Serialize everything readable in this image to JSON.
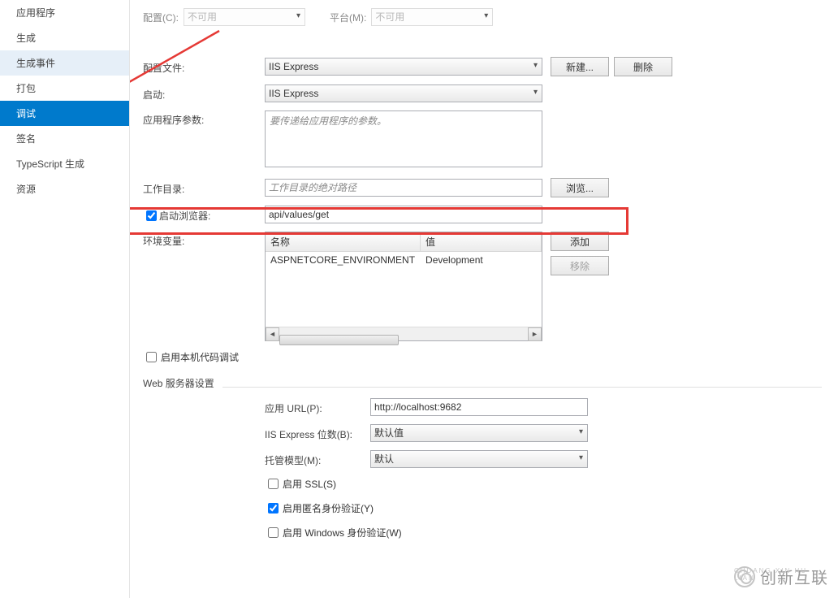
{
  "sidebar": {
    "items": [
      {
        "label": "应用程序"
      },
      {
        "label": "生成"
      },
      {
        "label": "生成事件"
      },
      {
        "label": "打包"
      },
      {
        "label": "调试"
      },
      {
        "label": "签名"
      },
      {
        "label": "TypeScript 生成"
      },
      {
        "label": "资源"
      }
    ],
    "selected_index": 4,
    "branch_index": 2
  },
  "toolbar": {
    "config_label": "配置(C):",
    "config_value": "不可用",
    "platform_label": "平台(M):",
    "platform_value": "不可用"
  },
  "profile": {
    "label": "配置文件:",
    "value": "IIS Express",
    "new_btn": "新建...",
    "delete_btn": "删除"
  },
  "launch": {
    "label": "启动:",
    "value": "IIS Express"
  },
  "app_args": {
    "label": "应用程序参数:",
    "placeholder": "要传递给应用程序的参数。"
  },
  "working_dir": {
    "label": "工作目录:",
    "placeholder": "工作目录的绝对路径",
    "browse_btn": "浏览..."
  },
  "launch_browser": {
    "label": "启动浏览器:",
    "checked": true,
    "value": "api/values/get"
  },
  "env_vars": {
    "label": "环境变量:",
    "columns": {
      "name": "名称",
      "value": "值"
    },
    "rows": [
      {
        "name": "ASPNETCORE_ENVIRONMENT",
        "value": "Development"
      }
    ],
    "add_btn": "添加",
    "remove_btn": "移除"
  },
  "native_debug": {
    "label": "启用本机代码调试",
    "checked": false
  },
  "web_section": {
    "title": "Web 服务器设置",
    "app_url_label": "应用 URL(P):",
    "app_url_value": "http://localhost:9682",
    "iis_express_bits_label": "IIS Express 位数(B):",
    "iis_express_bits_value": "默认值",
    "hosting_model_label": "托管模型(M):",
    "hosting_model_value": "默认",
    "enable_ssl_label": "启用 SSL(S)",
    "enable_ssl_checked": false,
    "enable_anon_label": "启用匿名身份验证(Y)",
    "enable_anon_checked": true,
    "enable_windows_label": "启用 Windows 身份验证(W)",
    "enable_windows_checked": false
  },
  "watermark": {
    "big": "创新互联",
    "small": "CHUANG XIN HU LIAN"
  }
}
